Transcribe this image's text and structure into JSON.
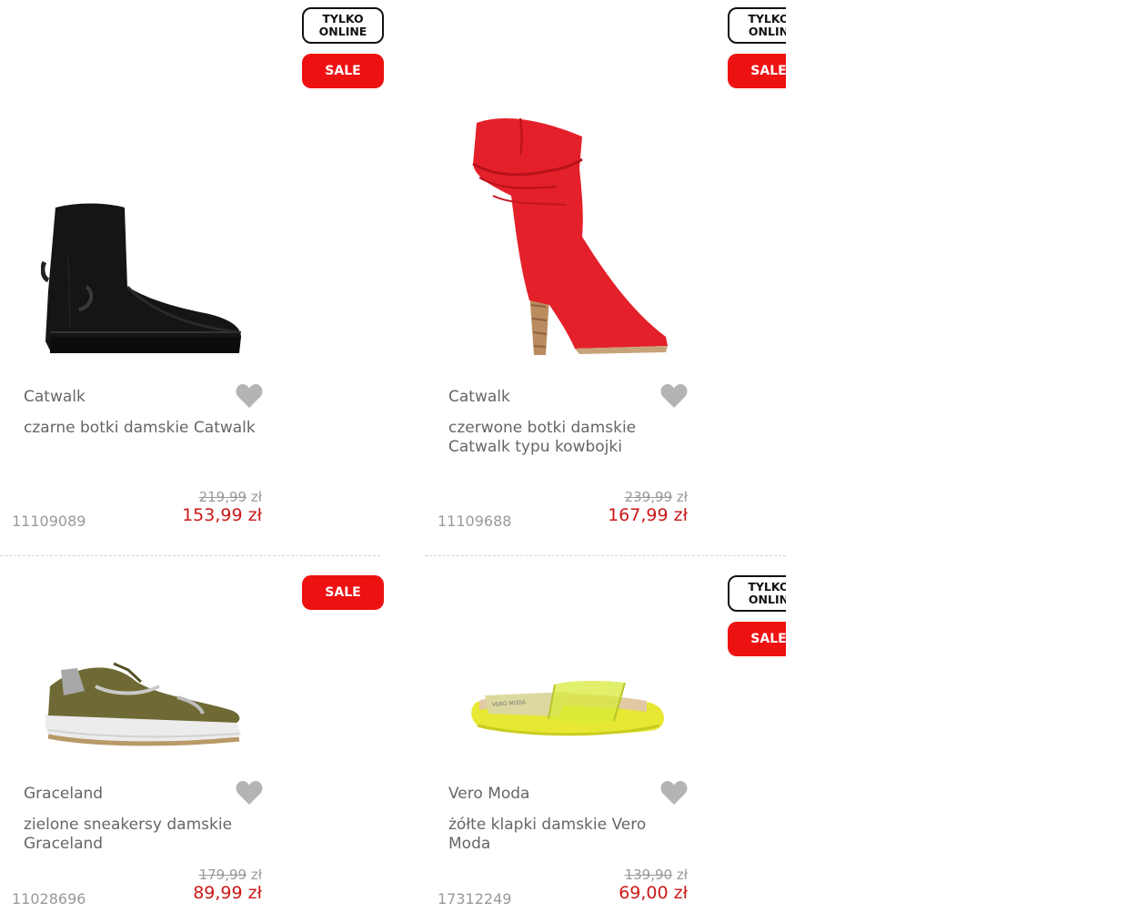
{
  "colors": {
    "sale": "#ee1111",
    "price": "#cc1818",
    "text": "#666666",
    "muted": "#999999"
  },
  "products": [
    {
      "badge_online": "TYLKO\nONLINE",
      "badge_sale": "SALE",
      "brand": "Catwalk",
      "name": "czarne botki damskie Catwalk",
      "old_price": "219,99",
      "currency": "zł",
      "price": "153,99 zł",
      "sku": "11109089",
      "image": "black-sock-boot"
    },
    {
      "badge_online": "TYLKO\nONLIN",
      "badge_sale": "SALE",
      "brand": "Catwalk",
      "name": "czerwone botki damskie Catwalk typu kowbojki",
      "old_price": "239,99",
      "currency": "zł",
      "price": "167,99 zł",
      "sku": "11109688",
      "image": "red-cowboy-boot"
    },
    {
      "badge_sale": "SALE",
      "brand": "Graceland",
      "name": "zielone sneakersy damskie Graceland",
      "old_price": "179,99",
      "currency": "zł",
      "price": "89,99 zł",
      "sku": "11028696",
      "image": "green-sneaker"
    },
    {
      "badge_online": "TYLKO\nONLIN",
      "badge_sale": "SALE",
      "brand": "Vero Moda",
      "name": "żółte klapki damskie Vero Moda",
      "old_price": "139,90",
      "currency": "zł",
      "price": "69,00 zł",
      "sku": "17312249",
      "image": "yellow-slide-sandal"
    }
  ]
}
